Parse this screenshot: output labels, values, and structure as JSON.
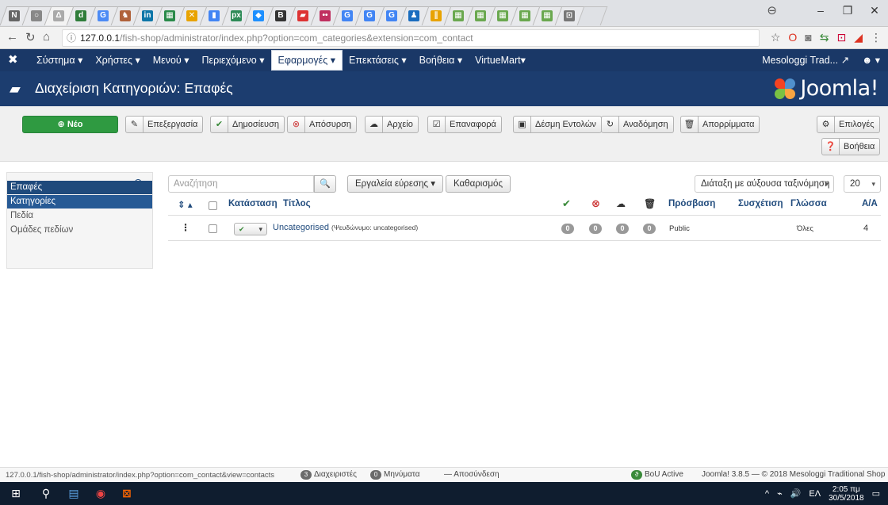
{
  "browser": {
    "url_info": "ⓘ",
    "url_host": "127.0.0.1",
    "url_path": "/fish-shop/administrator/index.php?option=com_categories&extension=com_contact",
    "window_minimize": "–",
    "window_maximize": "❐",
    "window_close": "✕"
  },
  "topnav": {
    "menu": [
      "Σύστημα ▾",
      "Χρήστες ▾",
      "Μενού ▾",
      "Περιεχόμενο ▾",
      "Εφαρμογές ▾",
      "Επεκτάσεις ▾",
      "Βοήθεια ▾",
      "VirtueMart▾"
    ],
    "active_index": 4,
    "site_name": "Mesologgi Trad...",
    "user_label": "▾"
  },
  "header": {
    "title": "Διαχείριση Κατηγοριών: Επαφές",
    "logo_text": "Joomla!"
  },
  "toolbar": {
    "new": "Νέο",
    "edit": "Επεξεργασία",
    "publish": "Δημοσίευση",
    "unpublish": "Απόσυρση",
    "archive": "Αρχείο",
    "checkin": "Επαναφορά",
    "batch": "Δέσμη Εντολών",
    "rebuild": "Αναδόμηση",
    "trash": "Απορρίμματα",
    "options": "Επιλογές",
    "help": "Βοήθεια"
  },
  "sidebar": {
    "items": [
      "Επαφές",
      "Κατηγορίες",
      "Πεδία",
      "Ομάδες πεδίων"
    ]
  },
  "filters": {
    "search_placeholder": "Αναζήτηση",
    "search_tools": "Εργαλεία εύρεσης ▾",
    "clear": "Καθαρισμός",
    "ordering": "Διάταξη με αύξουσα ταξινόμηση",
    "limit": "20"
  },
  "table": {
    "headers": {
      "sort": "⇕ ▴",
      "status": "Κατάσταση",
      "title": "Τίτλος",
      "access": "Πρόσβαση",
      "association": "Συσχέτιση",
      "language": "Γλώσσα",
      "id": "Α/Α"
    },
    "rows": [
      {
        "title": "Uncategorised",
        "alias": "(Ψευδώνυμο: uncategorised)",
        "published": "0",
        "unpublished": "0",
        "archived": "0",
        "trashed": "0",
        "access": "Public",
        "language": "Όλες",
        "id": "4"
      }
    ]
  },
  "statusbar": {
    "link_url": "127.0.0.1/fish-shop/administrator/index.php?option=com_contact&view=contacts",
    "admins_count": "3",
    "admins_label": "Διαχειριστές",
    "messages_count": "0",
    "messages_label": "Μηνύματα",
    "logout": "— Αποσύνδεση",
    "bou": "BoU Active",
    "copyright": "Joomla! 3.8.5 — © 2018 Mesologgi Traditional Shop"
  },
  "taskbar": {
    "lang": "ΕΛ",
    "time": "2:05 πμ",
    "date": "30/5/2018"
  },
  "colors": {
    "nav_bg": "#1a3867",
    "header_bg": "#1c3d6f",
    "new_button": "#2f9a41",
    "sidebar_active": "#1f4a7c",
    "link": "#1f4a7c"
  }
}
